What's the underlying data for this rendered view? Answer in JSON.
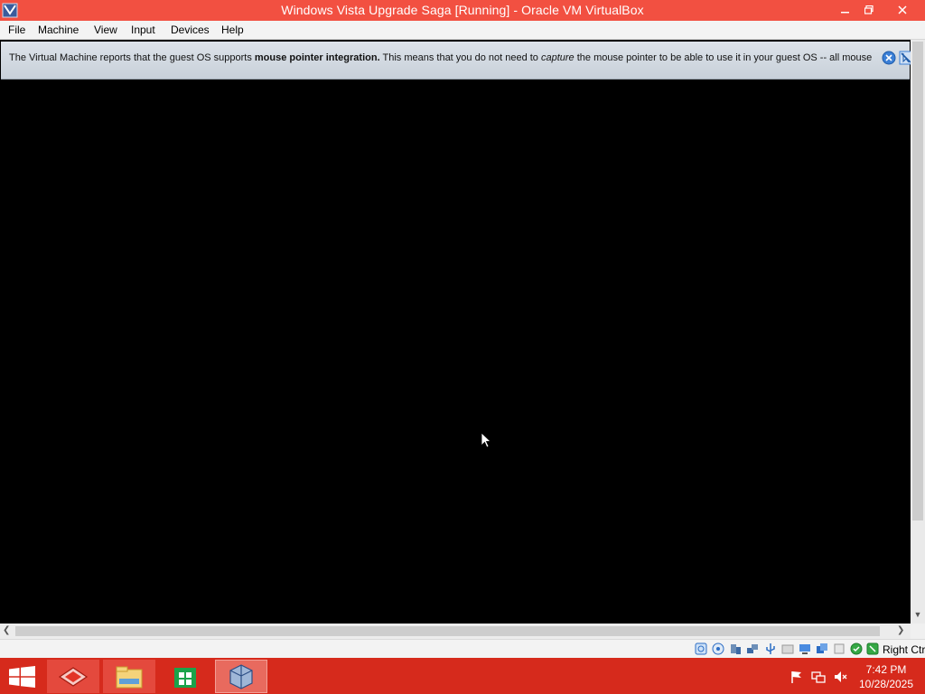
{
  "window": {
    "title": "Windows Vista Upgrade Saga [Running] - Oracle VM VirtualBox"
  },
  "menu": {
    "items": [
      "File",
      "Machine",
      "View",
      "Input",
      "Devices",
      "Help"
    ]
  },
  "notification": {
    "text_1": "The Virtual Machine reports that the guest OS supports ",
    "bold": "mouse pointer integration.",
    "text_2": " This means that you do not need to ",
    "italic": "capture",
    "text_3": " the mouse pointer to be able to use it in your guest OS -- all mouse"
  },
  "statusbar": {
    "host_key": "Right Ctrl",
    "icons": [
      "hard-disk-icon",
      "optical-drive-icon",
      "audio-icon",
      "network-icon",
      "usb-icon",
      "shared-folders-icon",
      "display-icon",
      "video-capture-icon",
      "cpu-icon",
      "mouse-integration-icon",
      "keyboard-capture-icon"
    ]
  },
  "taskbar": {
    "items": [
      "virtualbox-manager-icon",
      "file-explorer-icon",
      "store-icon",
      "virtualbox-vm-icon"
    ],
    "time": "7:42 PM",
    "date": "10/28/2025"
  },
  "colors": {
    "titlebar": "#f25041",
    "taskbar": "#d62a1c"
  }
}
